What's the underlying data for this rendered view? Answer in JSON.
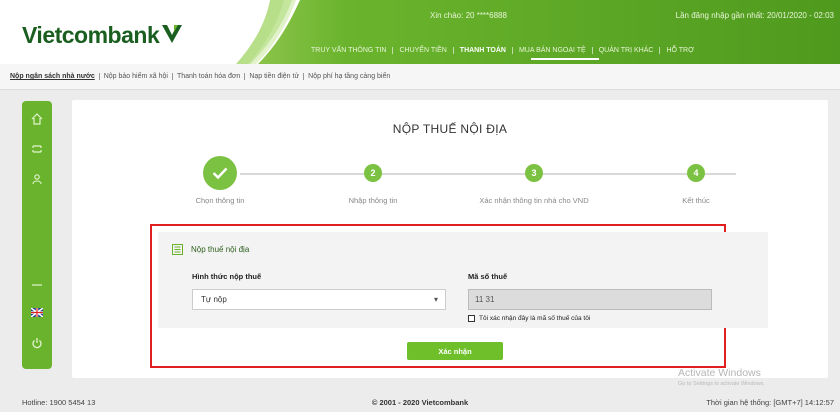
{
  "brand": {
    "name": "Vietcombank",
    "primary_color": "#6ab42d",
    "dark_color": "#1a5e20",
    "alert_color": "#e02020"
  },
  "header": {
    "user_info": "Xin chào: 20 ****6888",
    "last_login": "Lần đăng nhập gần nhất: 20/01/2020 - 02:03",
    "nav": [
      {
        "label": "TRUY VẤN THÔNG TIN",
        "active": false
      },
      {
        "label": "CHUYỂN TIỀN",
        "active": false
      },
      {
        "label": "THANH TOÁN",
        "active": true
      },
      {
        "label": "MUA BÁN NGOẠI TỆ",
        "active": false
      },
      {
        "label": "QUẢN TRỊ KHÁC",
        "active": false
      },
      {
        "label": "HỖ TRỢ",
        "active": false
      }
    ]
  },
  "subnav": {
    "items": [
      "Nộp ngân sách nhà nước",
      "Nộp bảo hiểm xã hội",
      "Thanh toán hóa đơn",
      "Nạp tiền điện tử",
      "Nộp phí hạ tầng cảng biển"
    ]
  },
  "sidebar": {
    "icons": [
      "home-icon",
      "menu-icon",
      "user-icon",
      "dash-icon",
      "uk-flag-icon",
      "power-icon"
    ]
  },
  "page": {
    "title": "NỘP THUẾ NỘI ĐỊA",
    "steps": [
      {
        "number": "✓",
        "label": "Chọn thông tin",
        "done": true
      },
      {
        "number": "2",
        "label": "Nhập thông tin",
        "done": false
      },
      {
        "number": "3",
        "label": "Xác nhận thông tin nhà cho VND",
        "done": false
      },
      {
        "number": "4",
        "label": "Kết thúc",
        "done": false
      }
    ]
  },
  "form": {
    "heading": "Nộp thuế nội địa",
    "method_label": "Hình thức nộp thuế",
    "method_value": "Tự nộp",
    "tax_code_label": "Mã số thuế",
    "tax_code_value": "11 31",
    "confirm_text": "Tôi xác nhận đây là mã số thuế của tôi",
    "submit_label": "Xác nhận"
  },
  "footer": {
    "hotline": "Hotline: 1900 5454 13",
    "copyright": "© 2001 - 2020 Vietcombank",
    "server_time": "Thời gian hệ thống: [GMT+7] 14:12:57"
  },
  "watermark": {
    "title": "Activate Windows",
    "subtitle": "Go to Settings to activate Windows."
  }
}
